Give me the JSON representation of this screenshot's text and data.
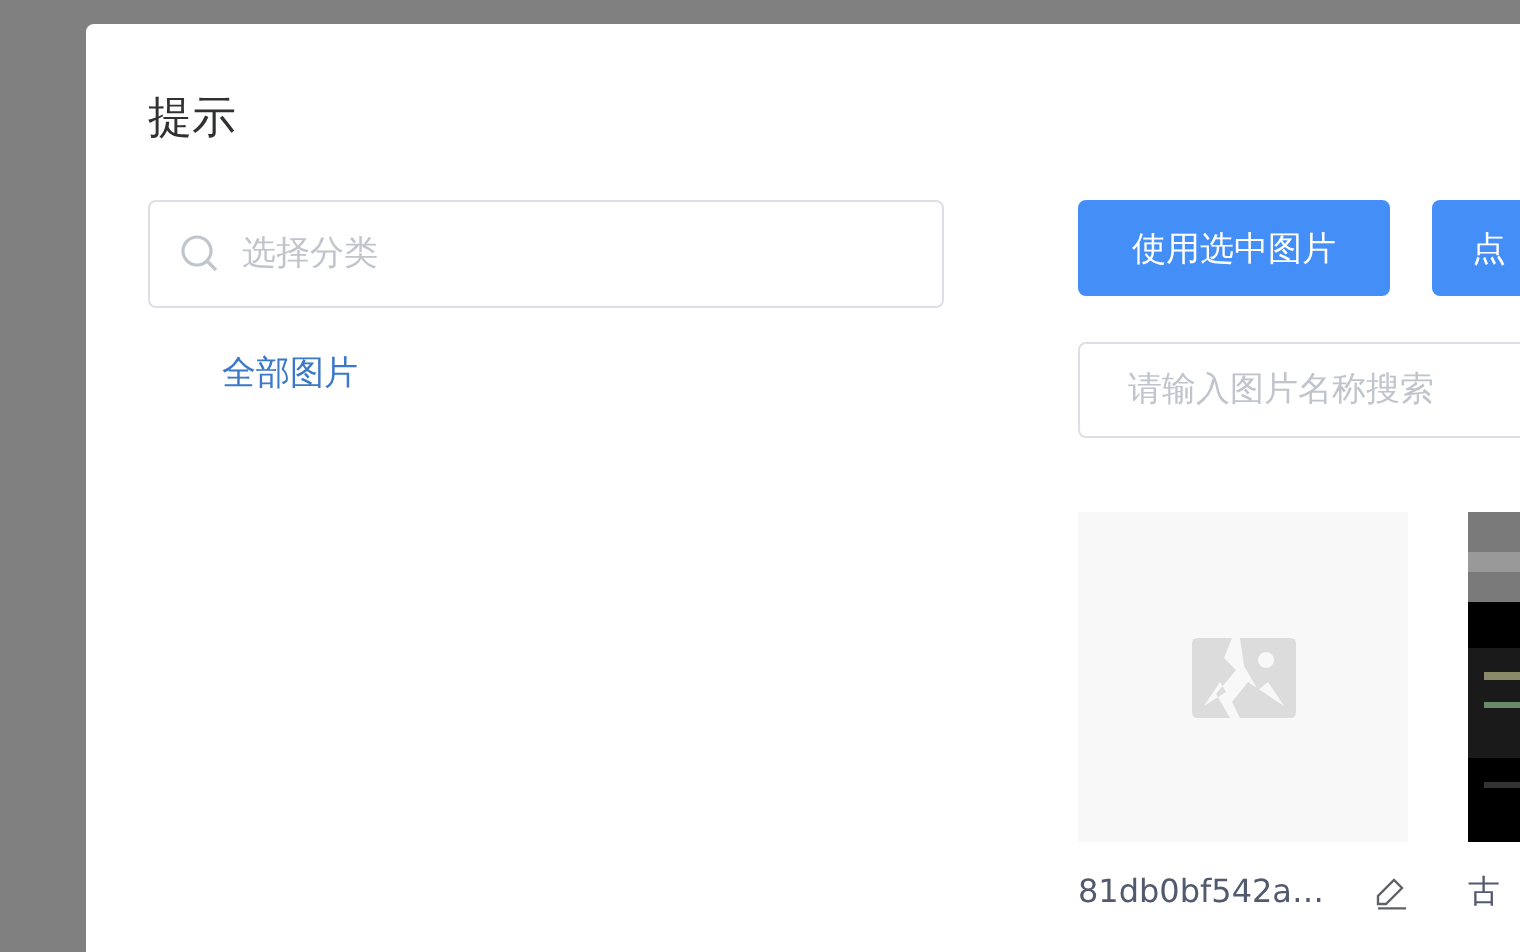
{
  "dialog": {
    "title": "提示"
  },
  "category_search": {
    "placeholder": "选择分类"
  },
  "categories": [
    {
      "label": "全部图片"
    }
  ],
  "buttons": [
    "使用选中图片",
    "点"
  ],
  "image_search": {
    "placeholder": "请输入图片名称搜索"
  },
  "images": [
    {
      "kind": "placeholder",
      "name": "81db0bf542a…"
    },
    {
      "kind": "picture",
      "name": "古"
    }
  ]
}
